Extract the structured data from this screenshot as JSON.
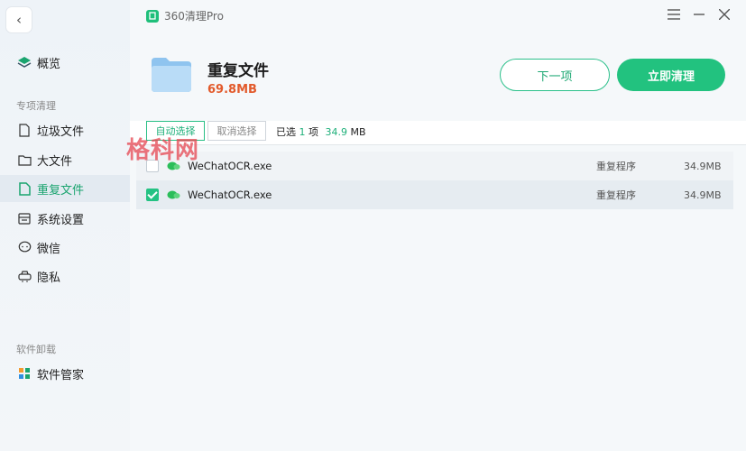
{
  "app": {
    "title": "360清理Pro"
  },
  "sidebar": {
    "items_top": [
      {
        "label": "概览",
        "icon": "layers-icon"
      }
    ],
    "section1": "专项清理",
    "items": [
      {
        "label": "垃圾文件",
        "icon": "file-icon"
      },
      {
        "label": "大文件",
        "icon": "folder-icon"
      },
      {
        "label": "重复文件",
        "icon": "duplicate-file-icon",
        "active": true
      },
      {
        "label": "系统设置",
        "icon": "settings-panel-icon"
      },
      {
        "label": "微信",
        "icon": "chat-icon"
      },
      {
        "label": "隐私",
        "icon": "privacy-icon"
      }
    ],
    "section2": "软件卸载",
    "items2": [
      {
        "label": "软件管家",
        "icon": "apps-grid-icon"
      }
    ]
  },
  "header": {
    "title": "重复文件",
    "size": "69.8MB"
  },
  "buttons": {
    "next": "下一项",
    "clean": "立即清理"
  },
  "toolbar": {
    "auto_select": "自动选择",
    "cancel_select": "取消选择",
    "selected_prefix": "已选",
    "selected_count": "1",
    "selected_unit": "项",
    "selected_size": "34.9",
    "selected_size_unit": "MB"
  },
  "files": [
    {
      "name": "WeChatOCR.exe",
      "type": "重复程序",
      "size": "34.9MB",
      "checked": false
    },
    {
      "name": "WeChatOCR.exe",
      "type": "重复程序",
      "size": "34.9MB",
      "checked": true
    }
  ],
  "watermark": "格科网",
  "colors": {
    "accent": "#22c27f",
    "size_highlight": "#e25a2b"
  }
}
